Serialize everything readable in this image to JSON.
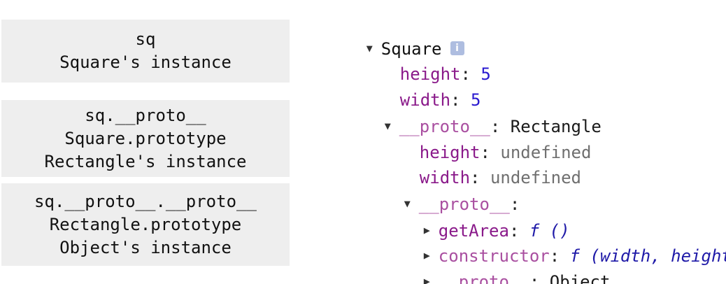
{
  "labels": [
    {
      "lines": [
        "sq",
        "Square's instance"
      ]
    },
    {
      "lines": [
        "sq.__proto__",
        "Square.prototype",
        "Rectangle's instance"
      ]
    },
    {
      "lines": [
        "sq.__proto__.__proto__",
        "Rectangle.prototype",
        "Object's instance"
      ]
    }
  ],
  "console": {
    "root": {
      "name": "Square",
      "expanded": true,
      "info_icon": "info-icon",
      "info_glyph": "i"
    },
    "height": {
      "key": "height",
      "value": "5"
    },
    "width": {
      "key": "width",
      "value": "5"
    },
    "proto1": {
      "key": "__proto__",
      "type": "Rectangle",
      "expanded": true
    },
    "proto1_height": {
      "key": "height",
      "value": "undefined"
    },
    "proto1_width": {
      "key": "width",
      "value": "undefined"
    },
    "proto2": {
      "key": "__proto__",
      "type": "",
      "expanded": true
    },
    "getArea": {
      "key": "getArea",
      "value": "f ()",
      "expanded": false
    },
    "constructor": {
      "key": "constructor",
      "value": "f (width, height)",
      "expanded": false
    },
    "proto3": {
      "key": "__proto__",
      "type": "Object",
      "expanded": false
    },
    "colon": ":",
    "glyph_expanded": "▼",
    "glyph_collapsed": "▶"
  },
  "colors": {
    "key": "#8a1a8a",
    "number": "#2a1ad0",
    "undefined": "#6f6f6f",
    "function": "#1f1aa8",
    "label_bg": "#eeeeee",
    "info_icon_bg": "#aebde0"
  }
}
